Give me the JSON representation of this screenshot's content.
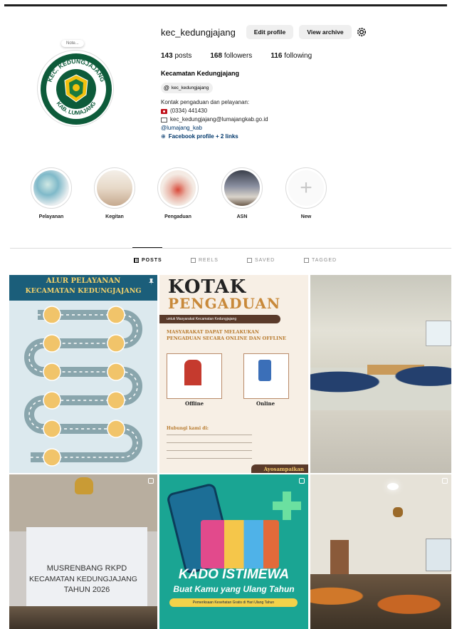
{
  "profile": {
    "username": "kec_kedungjajang",
    "edit_label": "Edit profile",
    "archive_label": "View archive",
    "note_label": "Note...",
    "stats": {
      "posts_count": "143",
      "posts_label": "posts",
      "followers_count": "168",
      "followers_label": "followers",
      "following_count": "116",
      "following_label": "following"
    },
    "full_name": "Kecamatan Kedungjajang",
    "threads_handle": "kec_kedungjajang",
    "bio": {
      "line1": "Kontak pengaduan dan pelayanan:",
      "phone": "(0334) 441430",
      "email": "kec_kedungjajang@lumajangkab.go.id",
      "mention": "@lumajang_kab",
      "links": "Facebook profile + 2 links"
    },
    "logo": {
      "top_text": "KEC. KEDUNGJAJANG",
      "bottom_text": "KAB. LUMAJANG"
    }
  },
  "highlights": [
    {
      "label": "Pelayanan"
    },
    {
      "label": "Kegitan"
    },
    {
      "label": "Pengaduan"
    },
    {
      "label": "ASN"
    },
    {
      "label": "New"
    }
  ],
  "tabs": [
    {
      "label": "POSTS",
      "active": true
    },
    {
      "label": "REELS",
      "active": false
    },
    {
      "label": "SAVED",
      "active": false
    },
    {
      "label": "TAGGED",
      "active": false
    }
  ],
  "posts": {
    "p1": {
      "title1": "ALUR PELAYANAN",
      "title2": "KECAMATAN KEDUNGJAJANG"
    },
    "p2": {
      "title1": "KOTAK",
      "title2": "PENGADUAN",
      "subtitle": "untuk Masyarakat Kecamatan Kedungjajang",
      "headline": "MASYARAKAT DAPAT MELAKUKAN PENGADUAN SECARA ONLINE DAN OFFLINE",
      "offline": "Offline",
      "online": "Online",
      "contact": "Hubungi kami di:",
      "footer": "Ayosampaikan"
    },
    "p4": {
      "line1": "MUSRENBANG RKPD",
      "line2": "KECAMATAN KEDUNGJAJANG",
      "line3": "TAHUN 2026"
    },
    "p5": {
      "title": "KADO ISTIMEWA",
      "subtitle": "Buat Kamu yang Ulang Tahun",
      "banner": "Pemeriksaan Kesehatan Gratis di Hari Ulang Tahun"
    }
  },
  "colors": {
    "accent_dark_green": "#0d5b3a",
    "link": "#00376b",
    "teal": "#1aa593",
    "brown": "#7a4a2a"
  }
}
